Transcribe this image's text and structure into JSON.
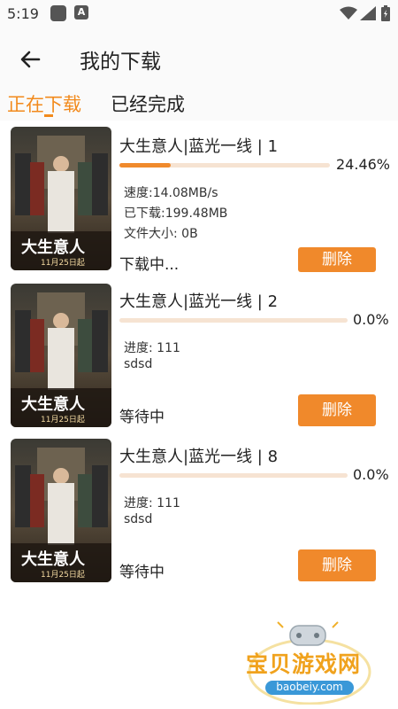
{
  "status_bar": {
    "time": "5:19",
    "notif_letter": "A"
  },
  "header": {
    "title": "我的下载"
  },
  "tabs": [
    {
      "label": "正在下载",
      "active": true
    },
    {
      "label": "已经完成",
      "active": false
    }
  ],
  "colors": {
    "accent": "#f28a1c",
    "track": "#f6e3d2",
    "button": "#f0892b"
  },
  "poster": {
    "title_art": "大生意人",
    "date": "11月25日起"
  },
  "downloads": [
    {
      "title": "大生意人|蓝光一线 | 1",
      "progress": 24.46,
      "progress_text": "24.46%",
      "info": [
        "速度:14.08MB/s",
        "已下载:199.48MB",
        "文件大小:  0B"
      ],
      "status": "下载中...",
      "delete_label": "删除"
    },
    {
      "title": "大生意人|蓝光一线 | 2",
      "progress": 0.0,
      "progress_text": "0.0%",
      "info": [
        "进度:  111",
        "sdsd"
      ],
      "status": "等待中",
      "delete_label": "删除"
    },
    {
      "title": "大生意人|蓝光一线 | 8",
      "progress": 0.0,
      "progress_text": "0.0%",
      "info": [
        "进度:  111",
        "sdsd"
      ],
      "status": "等待中",
      "delete_label": "删除"
    }
  ],
  "watermark": {
    "name": "宝贝游戏网",
    "url": "baobeiy.com"
  },
  "icons": {
    "back": "arrow-left-icon",
    "wifi": "wifi-icon",
    "signal": "signal-icon",
    "battery": "battery-icon"
  }
}
